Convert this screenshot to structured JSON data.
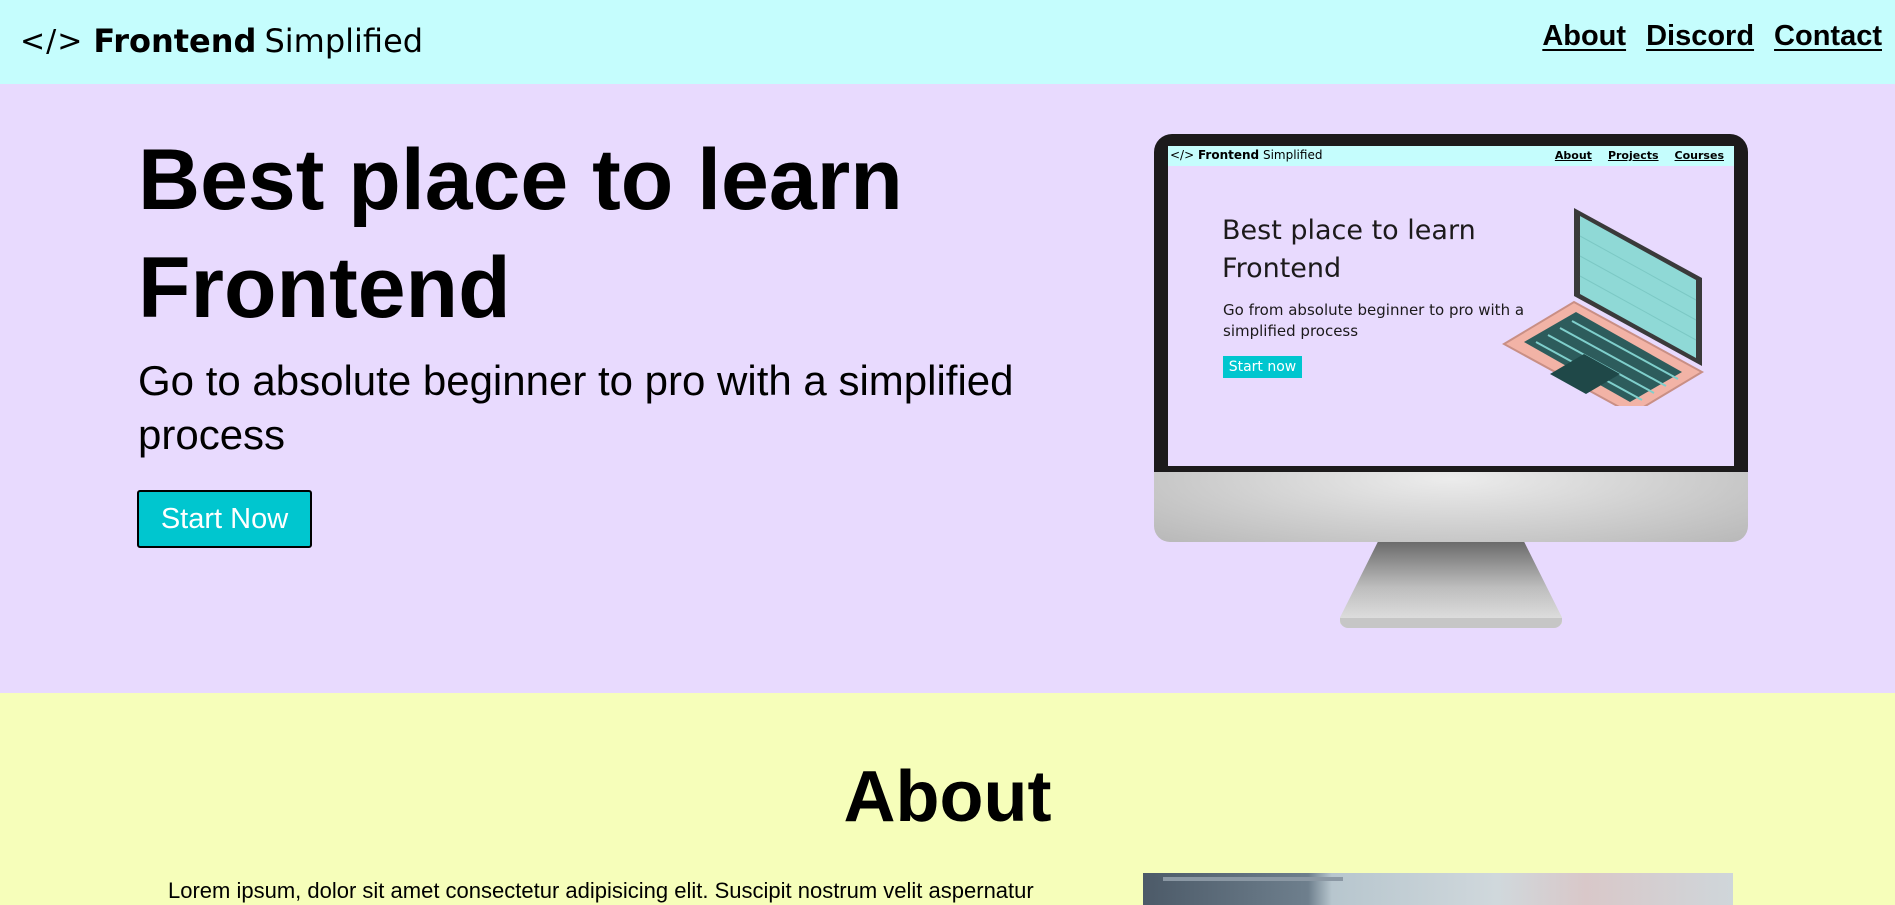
{
  "header": {
    "logo_icon": "</>",
    "logo_bold": "Frontend",
    "logo_light": "Simplified",
    "nav": [
      "About",
      "Discord",
      "Contact"
    ]
  },
  "hero": {
    "title": "Best place to learn Frontend",
    "subtitle": "Go to absolute beginner to pro with a simplified process",
    "cta_label": "Start Now",
    "illustration": {
      "mini_logo_icon": "</>",
      "mini_logo_bold": "Frontend",
      "mini_logo_light": "Simplified",
      "mini_nav": [
        "About",
        "Projects",
        "Courses"
      ],
      "mini_title": "Best place to learn Frontend",
      "mini_subtitle": "Go from absolute beginner to pro with a simplified process",
      "mini_button": "Start now"
    }
  },
  "about": {
    "title": "About",
    "text": "Lorem ipsum, dolor sit amet consectetur adipisicing elit. Suscipit nostrum velit aspernatur"
  },
  "colors": {
    "header_bg": "#c5fdfd",
    "hero_bg": "#e8dafe",
    "about_bg": "#f6feba",
    "accent": "#00c6cf"
  }
}
